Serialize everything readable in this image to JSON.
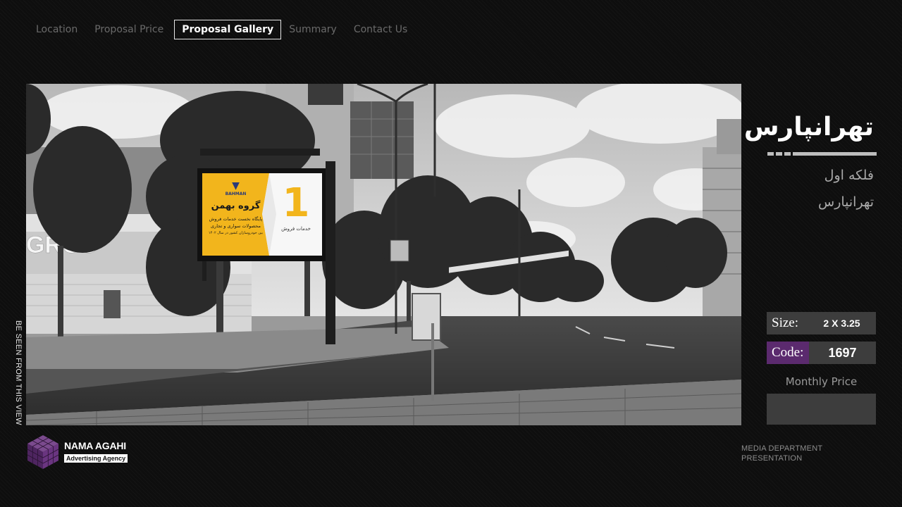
{
  "nav": {
    "items": [
      "Location",
      "Proposal Price",
      "Proposal Gallery",
      "Summary",
      "Contact Us"
    ],
    "active_index": 2
  },
  "photo": {
    "caption": "BE SEEN FROM THIS VIEW",
    "billboard": {
      "brand": "BAHMAN",
      "title": "گروه بهمن",
      "line1": "پایگاه نخست خدمات فروش",
      "line2": "محصولات سواری و تجاری",
      "line3": "بین خودروسازان کشور در سال ۱۴۰۲",
      "number": "1",
      "number_caption": "خدمات فروش"
    }
  },
  "panel": {
    "title": "تهرانپارس",
    "subtitle1": "فلکه اول",
    "subtitle2": "تهرانپارس",
    "size_label": "Size:",
    "size_value": "2 X 3.25",
    "code_label": "Code:",
    "code_value": "1697",
    "monthly_price_label": "Monthly Price",
    "monthly_price_value": ""
  },
  "footer": {
    "logo_name": "NAMA AGAHI",
    "logo_tagline": "Advertising Agency",
    "media_line1": "MEDIA DEPARTMENT",
    "media_line2": "PRESENTATION"
  },
  "colors": {
    "accent_purple": "#5b2a6e",
    "billboard_yellow": "#f2b51c",
    "box_gray": "#3d3d3d"
  }
}
